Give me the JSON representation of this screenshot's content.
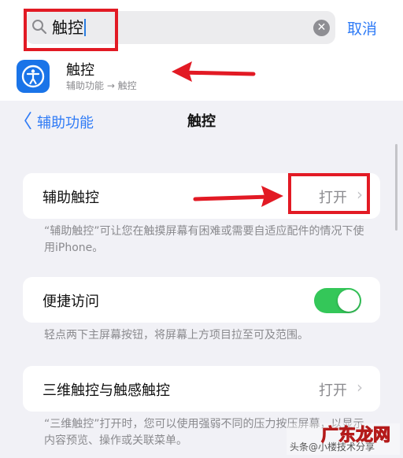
{
  "search": {
    "query": "触控",
    "cancel_label": "取消"
  },
  "result": {
    "title": "触控",
    "subtitle": "辅助功能 → 触控"
  },
  "nav": {
    "back_label": "辅助功能",
    "title": "触控"
  },
  "settings": {
    "assistive_touch": {
      "label": "辅助触控",
      "value": "打开"
    },
    "assistive_touch_note": "“辅助触控”可让您在触摸屏幕有困难或需要自适应配件的情况下使用iPhone。",
    "reachability": {
      "label": "便捷访问",
      "enabled": true
    },
    "reachability_note": "轻点两下主屏幕按钮，将屏幕上方项目拉至可及范围。",
    "haptic": {
      "label": "三维触控与触感触控",
      "value": "打开"
    },
    "haptic_note": "“三维触控”打开时，您可以使用强弱不同的压力按压屏幕，以显示内容预览、操作或关联菜单。"
  },
  "watermark": {
    "text": "头条@小楼技术分享 广东龙网"
  },
  "colors": {
    "accent": "#2f7bf6",
    "toggle_on": "#34c759",
    "annotation": "#e21a24"
  }
}
